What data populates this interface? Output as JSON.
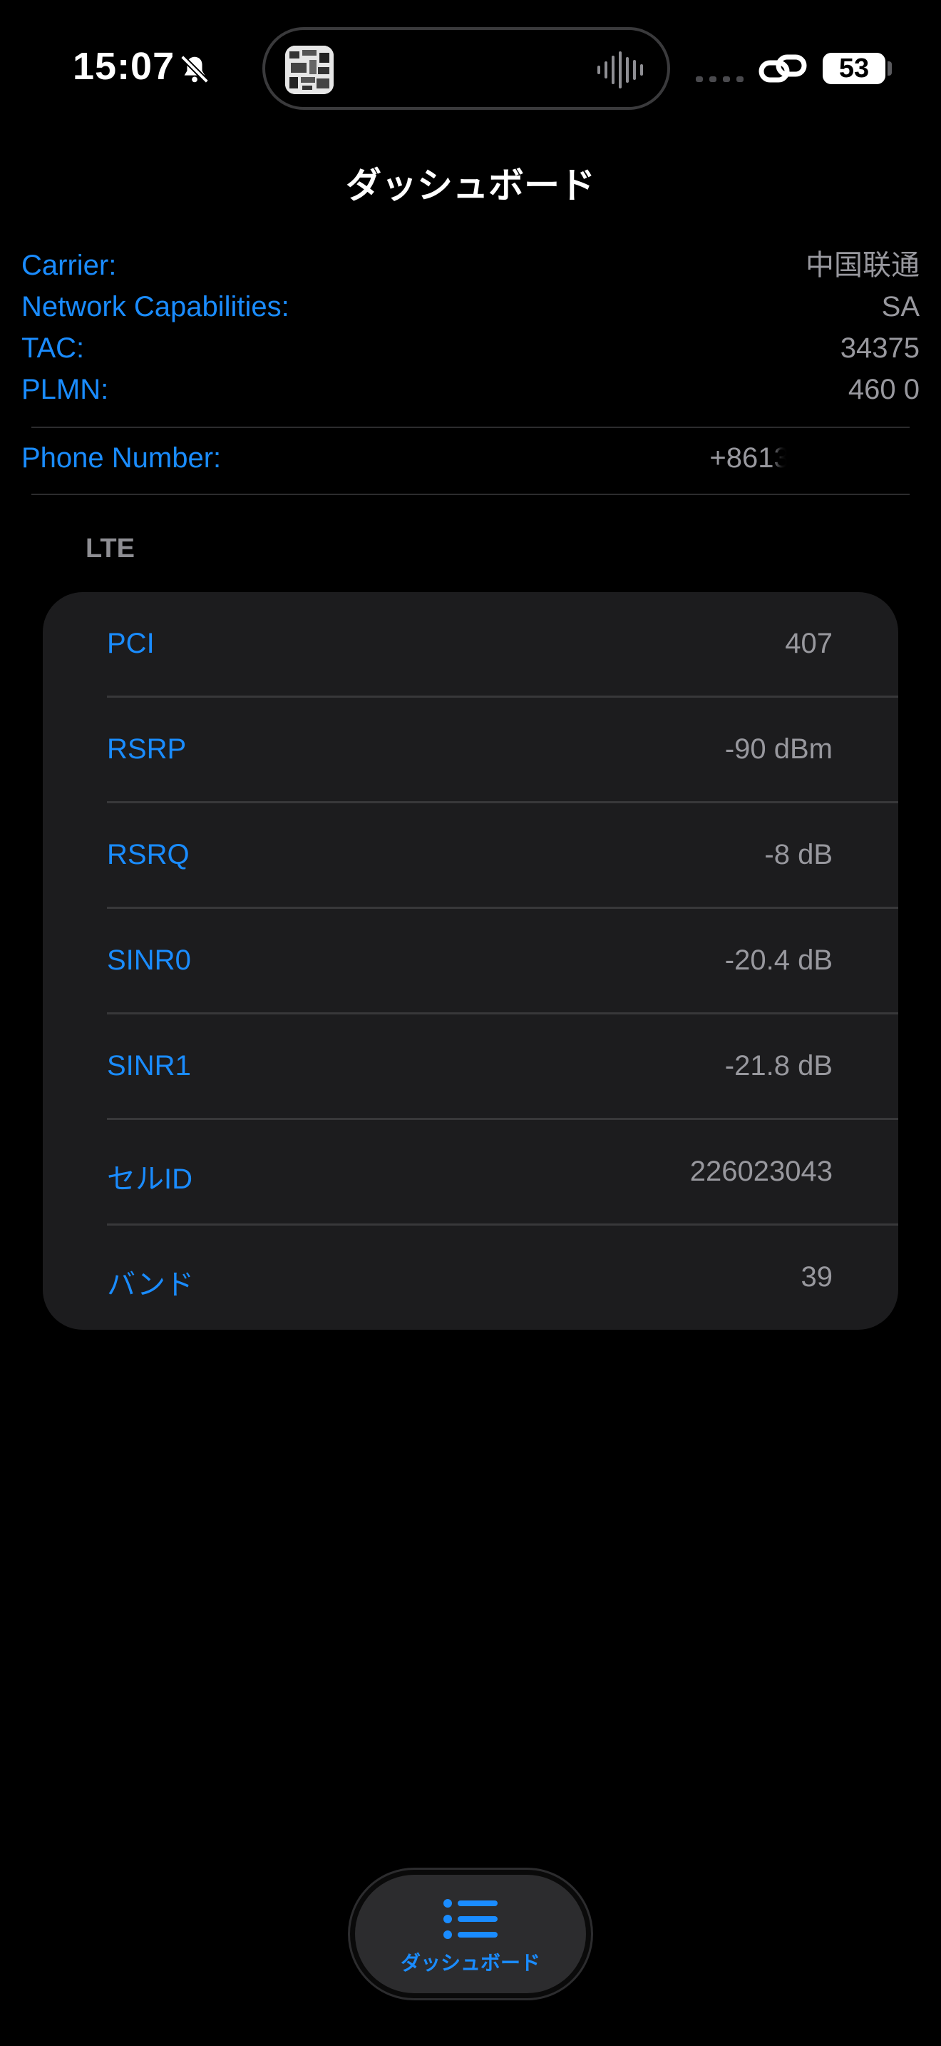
{
  "status_bar": {
    "time": "15:07",
    "battery": "53",
    "icons": [
      "bell-slash-icon",
      "link-icon",
      "signal-dots-icon",
      "waveform-icon"
    ]
  },
  "nav": {
    "title": "ダッシュボード"
  },
  "info": {
    "carrier": {
      "label": "Carrier:",
      "value": "中国联通"
    },
    "network_capabilities": {
      "label": "Network Capabilities:",
      "value": "SA"
    },
    "tac": {
      "label": "TAC:",
      "value": "34375"
    },
    "plmn": {
      "label": "PLMN:",
      "value": "460 0"
    },
    "phone_number": {
      "label": "Phone Number:",
      "value": "+86131"
    }
  },
  "section": {
    "header": "LTE",
    "rows": [
      {
        "label": "PCI",
        "value": "407"
      },
      {
        "label": "RSRP",
        "value": "-90 dBm"
      },
      {
        "label": "RSRQ",
        "value": "-8 dB"
      },
      {
        "label": "SINR0",
        "value": "-20.4 dB"
      },
      {
        "label": "SINR1",
        "value": "-21.8 dB"
      },
      {
        "label": "セルID",
        "value": "226023043"
      },
      {
        "label": "バンド",
        "value": "39"
      }
    ]
  },
  "tab_bar": {
    "dashboard_label": "ダッシュボード",
    "icon": "list-bullet-icon"
  },
  "colors": {
    "accent": "#1a8cff",
    "background": "#000000",
    "card": "#1c1c1e",
    "secondary_text": "#98989e"
  }
}
